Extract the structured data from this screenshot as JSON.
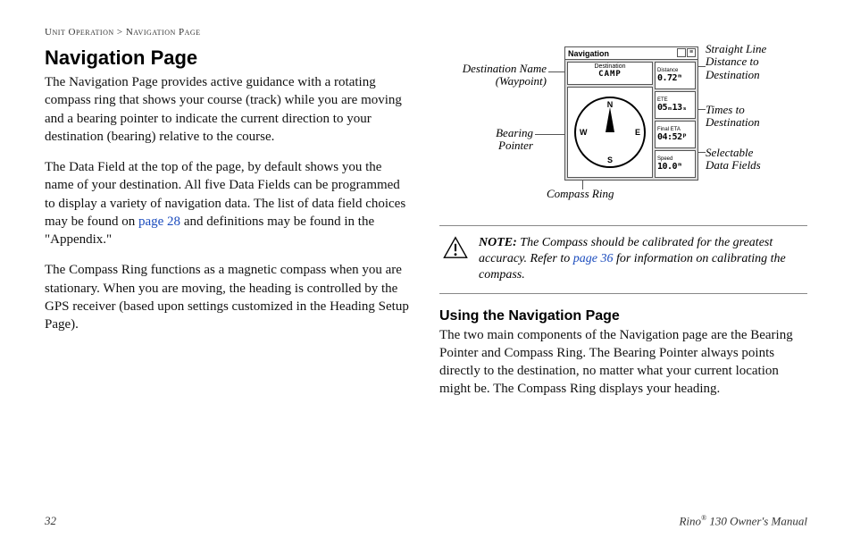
{
  "breadcrumb": {
    "part1": "Unit Operation",
    "sep": " > ",
    "part2": "Navigation Page"
  },
  "left": {
    "h1": "Navigation Page",
    "p1": "The Navigation Page provides active guidance with a rotating compass ring that shows your course (track) while you are moving and a bearing pointer to indicate the current direction to your destination (bearing) relative to the course.",
    "p2a": "The Data Field at the top of the page, by default shows you the name of your destination. All five Data Fields can be programmed to display a variety of navigation data. The list of data field choices may be found on ",
    "p2link": "page 28",
    "p2b": " and definitions may be found in the \"Appendix.\"",
    "p3": "The Compass Ring functions as a magnetic compass when you are stationary. When you are moving, the heading is controlled by the GPS receiver (based upon settings customized in the Heading Setup Page)."
  },
  "diagram": {
    "titlebar": "Navigation",
    "dest_label": "Destination",
    "dest_value": "CAMP",
    "fields": [
      {
        "label": "Distance",
        "value": "0.72ᵐ"
      },
      {
        "label": "ETE",
        "value": "05ₘ13ₛ"
      },
      {
        "label": "Final ETA",
        "value": "04:52ᵖ"
      },
      {
        "label": "Speed",
        "value": "10.0ᵐ"
      }
    ],
    "compass": {
      "N": "N",
      "S": "S",
      "E": "E",
      "W": "W"
    }
  },
  "callouts": {
    "dest_name": "Destination Name\n(Waypoint)",
    "bearing": "Bearing\nPointer",
    "compass_ring": "Compass Ring",
    "distance": "Straight Line\nDistance to\nDestination",
    "times": "Times to\nDestination",
    "selectable": "Selectable\nData Fields"
  },
  "note": {
    "label": "NOTE:",
    "text_a": " The Compass should be calibrated for the greatest accuracy. Refer to ",
    "link": "page 36",
    "text_b": " for information on calibrating the compass."
  },
  "right": {
    "h2": "Using the Navigation Page",
    "p1": "The two main components of the Navigation page are the Bearing Pointer and Compass Ring. The Bearing Pointer always points directly to the destination, no matter what your current location might be. The Compass Ring displays your heading."
  },
  "footer": {
    "page": "32",
    "doc_a": "Rino",
    "doc_sup": "®",
    "doc_b": " 130 Owner's Manual"
  }
}
